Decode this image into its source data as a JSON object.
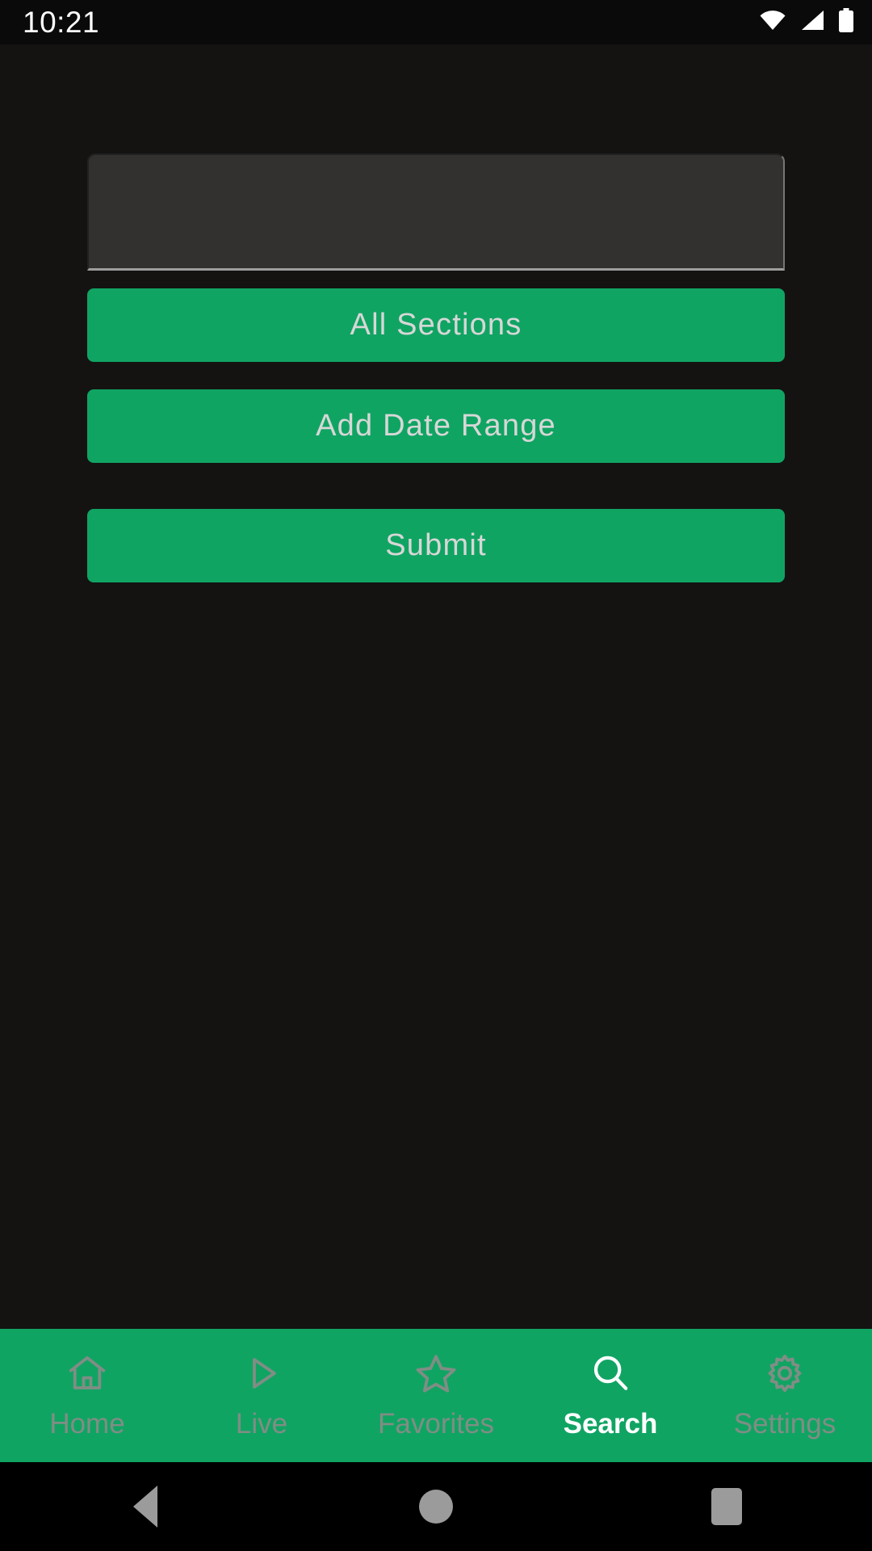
{
  "status_bar": {
    "clock": "10:21",
    "icons": [
      "wifi-icon",
      "cellular-signal-icon",
      "battery-icon"
    ]
  },
  "theme": {
    "background": "#141312",
    "accent_green": "#10a463",
    "field_background": "#333130",
    "field_underline": "#9d9d9d",
    "button_text": "#d7d7d7",
    "inactive_tab": "#808d85",
    "active_tab": "#ffffff",
    "divider": "#4a4a4a"
  },
  "search_form": {
    "query_input": {
      "value": "",
      "placeholder": ""
    },
    "sections_button": "All Sections",
    "date_range_button": "Add Date Range",
    "submit_button": "Submit"
  },
  "tab_bar": {
    "active_index": 3,
    "items": [
      {
        "label": "Home",
        "icon": "home-icon",
        "active": false
      },
      {
        "label": "Live",
        "icon": "play-icon",
        "active": false
      },
      {
        "label": "Favorites",
        "icon": "star-icon",
        "active": false
      },
      {
        "label": "Search",
        "icon": "search-icon",
        "active": true
      },
      {
        "label": "Settings",
        "icon": "gear-icon",
        "active": false
      }
    ]
  },
  "system_nav": {
    "back": "back-button",
    "home": "home-button",
    "recents": "recents-button"
  }
}
